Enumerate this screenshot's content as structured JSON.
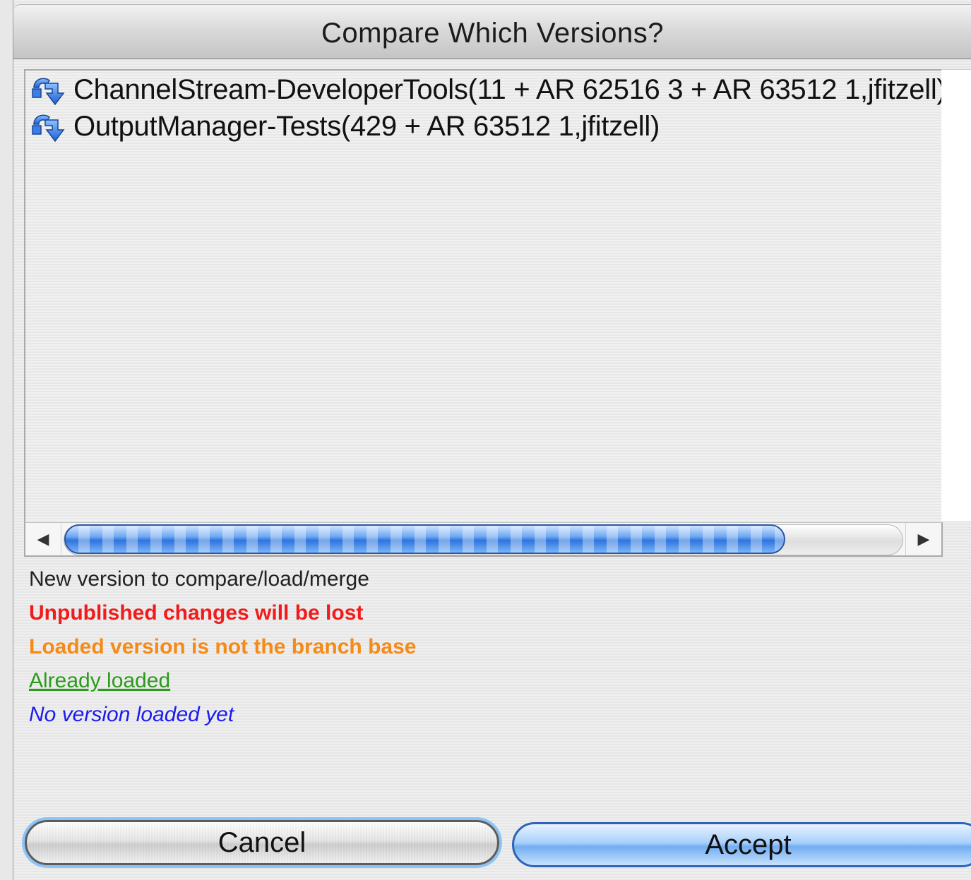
{
  "dialog": {
    "title": "Compare Which Versions?"
  },
  "list": {
    "items": [
      {
        "label": "ChannelStream-DeveloperTools(11 + AR 62516 3 + AR 63512 1,jfitzell)",
        "icon": "version-arrow-icon"
      },
      {
        "label": "OutputManager-Tests(429 + AR 63512 1,jfitzell)",
        "icon": "version-arrow-icon"
      }
    ]
  },
  "scrollbar": {
    "left_arrow": "◀",
    "right_arrow": "▶",
    "thumb_position": 0.0,
    "visible_fraction": 0.86
  },
  "legend": {
    "normal": "New version to compare/load/merge",
    "red": "Unpublished changes will be lost",
    "orange": "Loaded version is not the branch base",
    "green": "Already loaded",
    "blue": "No version loaded yet"
  },
  "buttons": {
    "cancel": "Cancel",
    "accept": "Accept"
  },
  "colors": {
    "red": "#f21b1b",
    "orange": "#f58a16",
    "green": "#2c9a1c",
    "blue": "#1b1bf0",
    "accent": "#2f74dc"
  }
}
